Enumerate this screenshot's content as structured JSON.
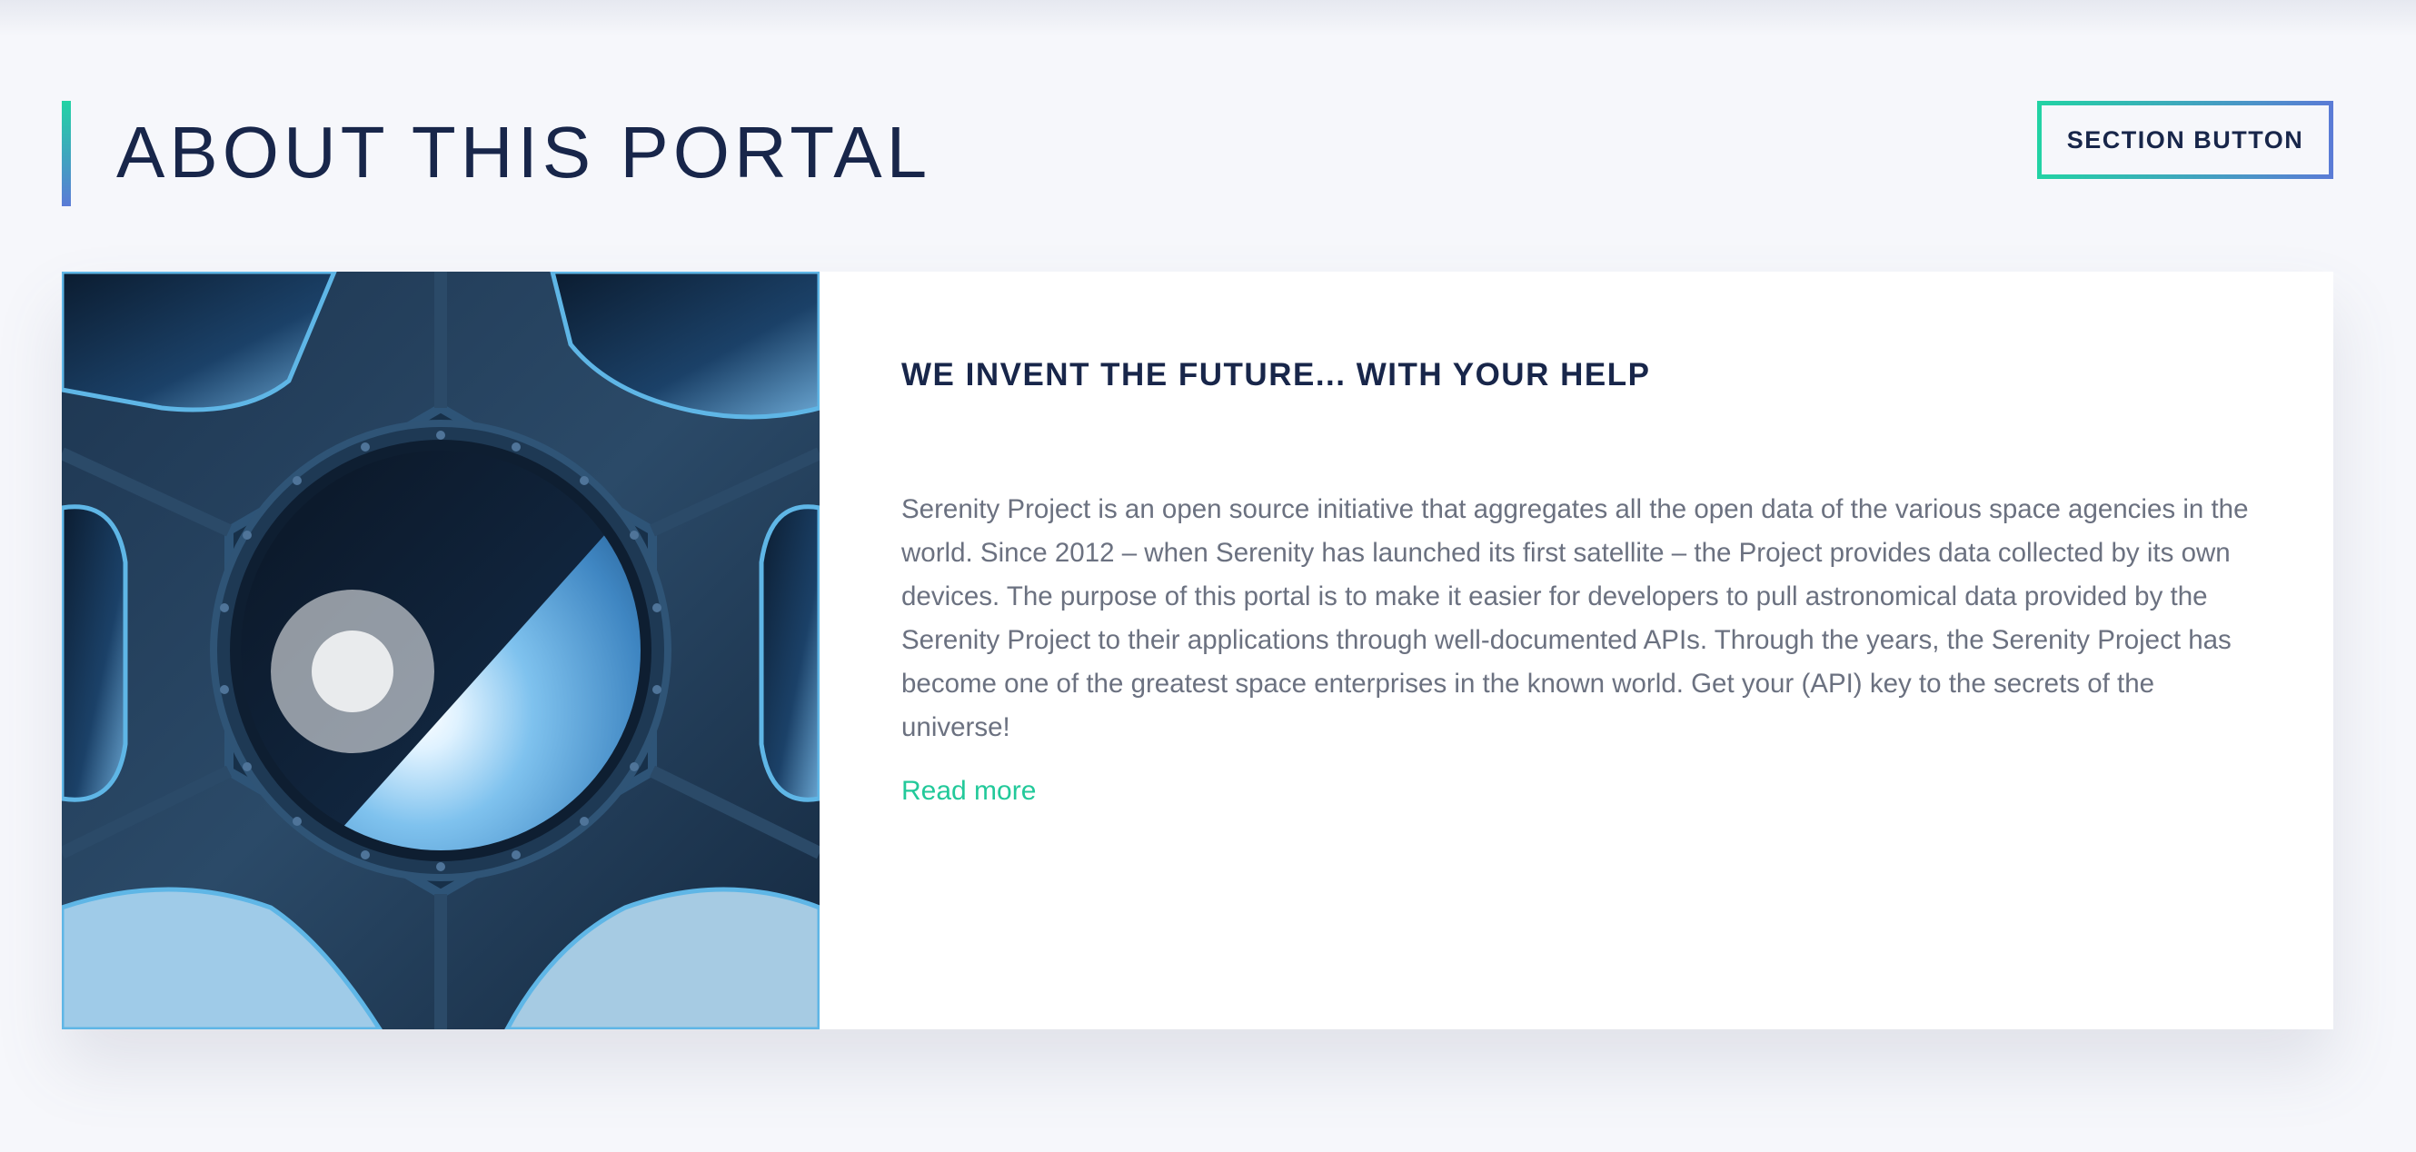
{
  "section": {
    "title": "ABOUT THIS PORTAL",
    "button_label": "SECTION BUTTON"
  },
  "card": {
    "image_alt_name": "space-station-window-earth-image",
    "heading": "WE INVENT THE FUTURE... WITH YOUR HELP",
    "body": "Serenity Project is an open source initiative that aggregates all the open data of the various space agencies in the world. Since 2012 – when Serenity has launched its first satellite – the Project provides data collected by its own devices. The purpose of this portal is to make it easier for developers to pull astronomical data provided by the Serenity Project to their applications through well-documented APIs. Through the years, the Serenity Project has become one of the greatest space enterprises in the known world. Get your (API) key to the secrets of the universe!",
    "read_more": "Read more"
  },
  "colors": {
    "accent_start": "#22d3a4",
    "accent_end": "#5b7bd6",
    "title": "#18264a",
    "body_text": "#6b7180",
    "link": "#22c99a",
    "background": "#f6f7fb"
  }
}
